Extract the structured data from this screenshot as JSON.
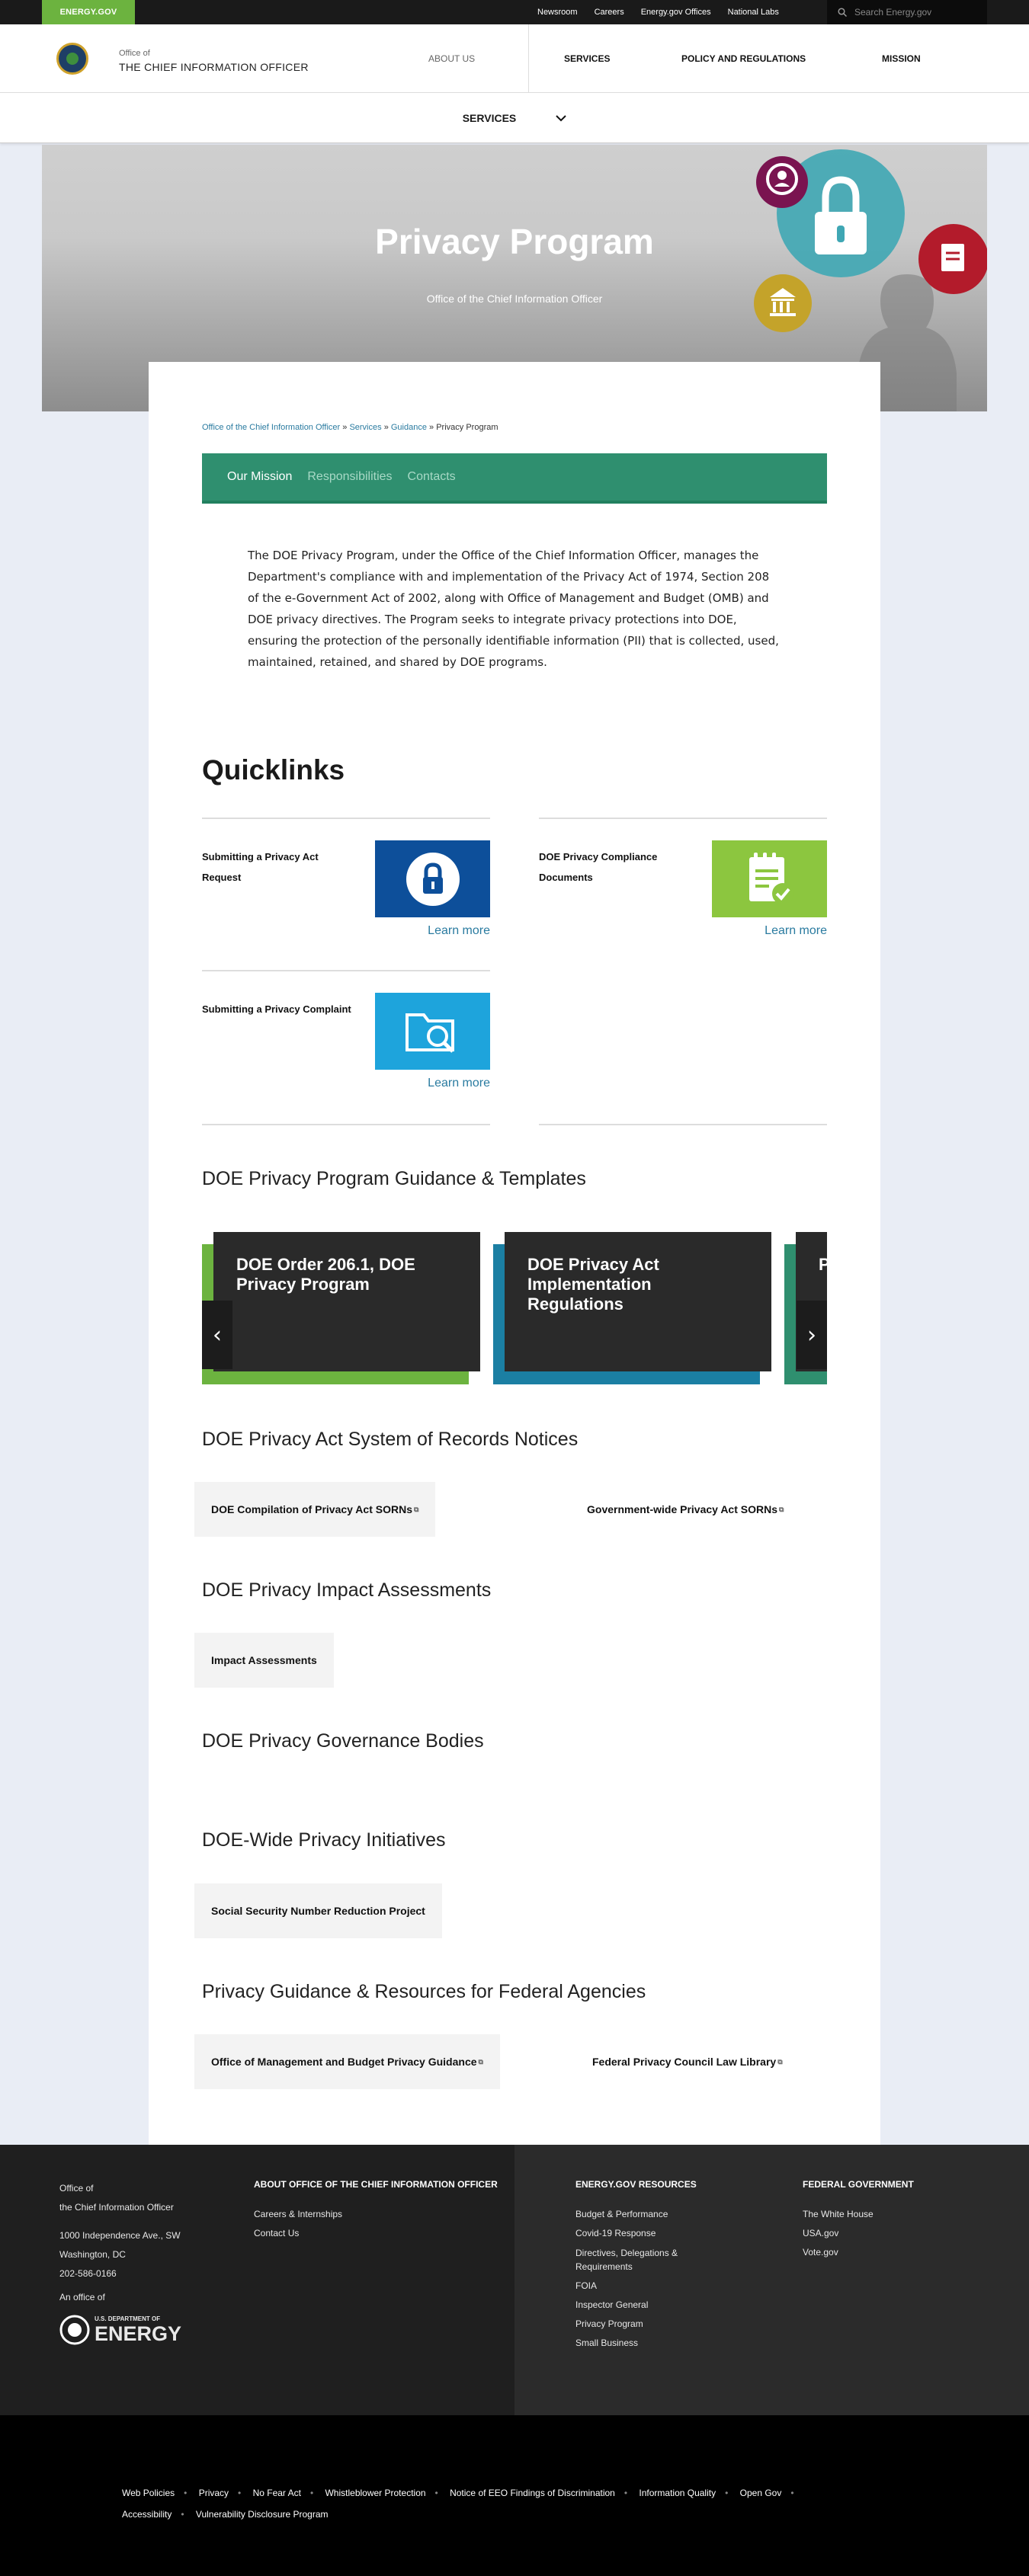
{
  "topbar": {
    "brand": "ENERGY.GOV",
    "links": [
      "Newsroom",
      "Careers",
      "Energy.gov Offices",
      "National Labs"
    ],
    "search_placeholder": "Search Energy.gov"
  },
  "header": {
    "office_of": "Office of",
    "office_name": "THE CHIEF INFORMATION OFFICER",
    "nav": [
      "ABOUT US",
      "SERVICES",
      "POLICY AND REGULATIONS",
      "MISSION"
    ]
  },
  "subnav": {
    "label": "SERVICES"
  },
  "hero": {
    "title": "Privacy Program",
    "subtitle": "Office of the Chief Information Officer"
  },
  "breadcrumb": {
    "items": [
      "Office of the Chief Information Officer",
      "Services",
      "Guidance"
    ],
    "separator": "»",
    "current": "Privacy Program"
  },
  "tabs": [
    "Our Mission",
    "Responsibilities",
    "Contacts"
  ],
  "intro": "The DOE Privacy Program, under the Office of the Chief Information Officer, manages the Department's compliance with and implementation of the Privacy Act of 1974, Section 208 of the e-Government Act of 2002, along with Office of Management and Budget (OMB) and DOE privacy directives.  The Program seeks to integrate privacy protections into DOE, ensuring the protection of the personally identifiable information (PII) that is collected, used, maintained, retained, and shared by DOE programs.",
  "quicklinks": {
    "heading": "Quicklinks",
    "learn_more": "Learn more",
    "items": [
      {
        "title": "Submitting a Privacy Act Request",
        "color": "#0d4f9a",
        "icon": "lock-icon"
      },
      {
        "title": "DOE Privacy Compliance Documents",
        "color": "#8cc63f",
        "icon": "document-check-icon"
      },
      {
        "title": "Submitting a Privacy Complaint",
        "color": "#1ea4dc",
        "icon": "folder-search-icon"
      }
    ]
  },
  "guidance": {
    "heading": "DOE Privacy Program Guidance & Templates",
    "slides": [
      {
        "title": "DOE Order 206.1, DOE Privacy Program",
        "color": "#6cb33f"
      },
      {
        "title": "DOE Privacy Act Implementation Regulations",
        "color": "#1b7fa3"
      },
      {
        "title": "P",
        "color": "#2f8f6f"
      }
    ]
  },
  "sorn": {
    "heading": "DOE Privacy Act System of Records Notices",
    "links": [
      "DOE Compilation of Privacy Act SORNs",
      "Government-wide Privacy Act SORNs"
    ]
  },
  "pia": {
    "heading": "DOE Privacy Impact Assessments",
    "links": [
      "Impact Assessments"
    ]
  },
  "governance": {
    "heading": "DOE Privacy Governance Bodies"
  },
  "initiatives": {
    "heading": "DOE-Wide Privacy Initiatives",
    "links": [
      "Social Security Number Reduction Project"
    ]
  },
  "federal": {
    "heading": "Privacy Guidance & Resources for Federal Agencies",
    "links": [
      "Office of Management and Budget Privacy Guidance",
      "Federal Privacy Council Law Library"
    ]
  },
  "footer": {
    "office_lines": [
      "Office of",
      "the Chief Information Officer"
    ],
    "address_lines": [
      "1000 Independence Ave., SW",
      "Washington, DC",
      "202-586-0166"
    ],
    "an_office_of": "An office of",
    "doe_small": "U.S. DEPARTMENT OF",
    "doe_big": "ENERGY",
    "about": {
      "heading": "ABOUT OFFICE OF THE CHIEF INFORMATION OFFICER",
      "links": [
        "Careers & Internships",
        "Contact Us"
      ]
    },
    "resources": {
      "heading": "ENERGY.GOV RESOURCES",
      "links": [
        "Budget & Performance",
        "Covid-19 Response",
        "Directives, Delegations & Requirements",
        "FOIA",
        "Inspector General",
        "Privacy Program",
        "Small Business"
      ]
    },
    "federal": {
      "heading": "FEDERAL GOVERNMENT",
      "links": [
        "The White House",
        "USA.gov",
        "Vote.gov"
      ]
    }
  },
  "bottom_links": [
    "Web Policies",
    "Privacy",
    "No Fear Act",
    "Whistleblower Protection",
    "Notice of EEO Findings of Discrimination",
    "Information Quality",
    "Open Gov",
    "Accessibility",
    "Vulnerability Disclosure Program"
  ]
}
